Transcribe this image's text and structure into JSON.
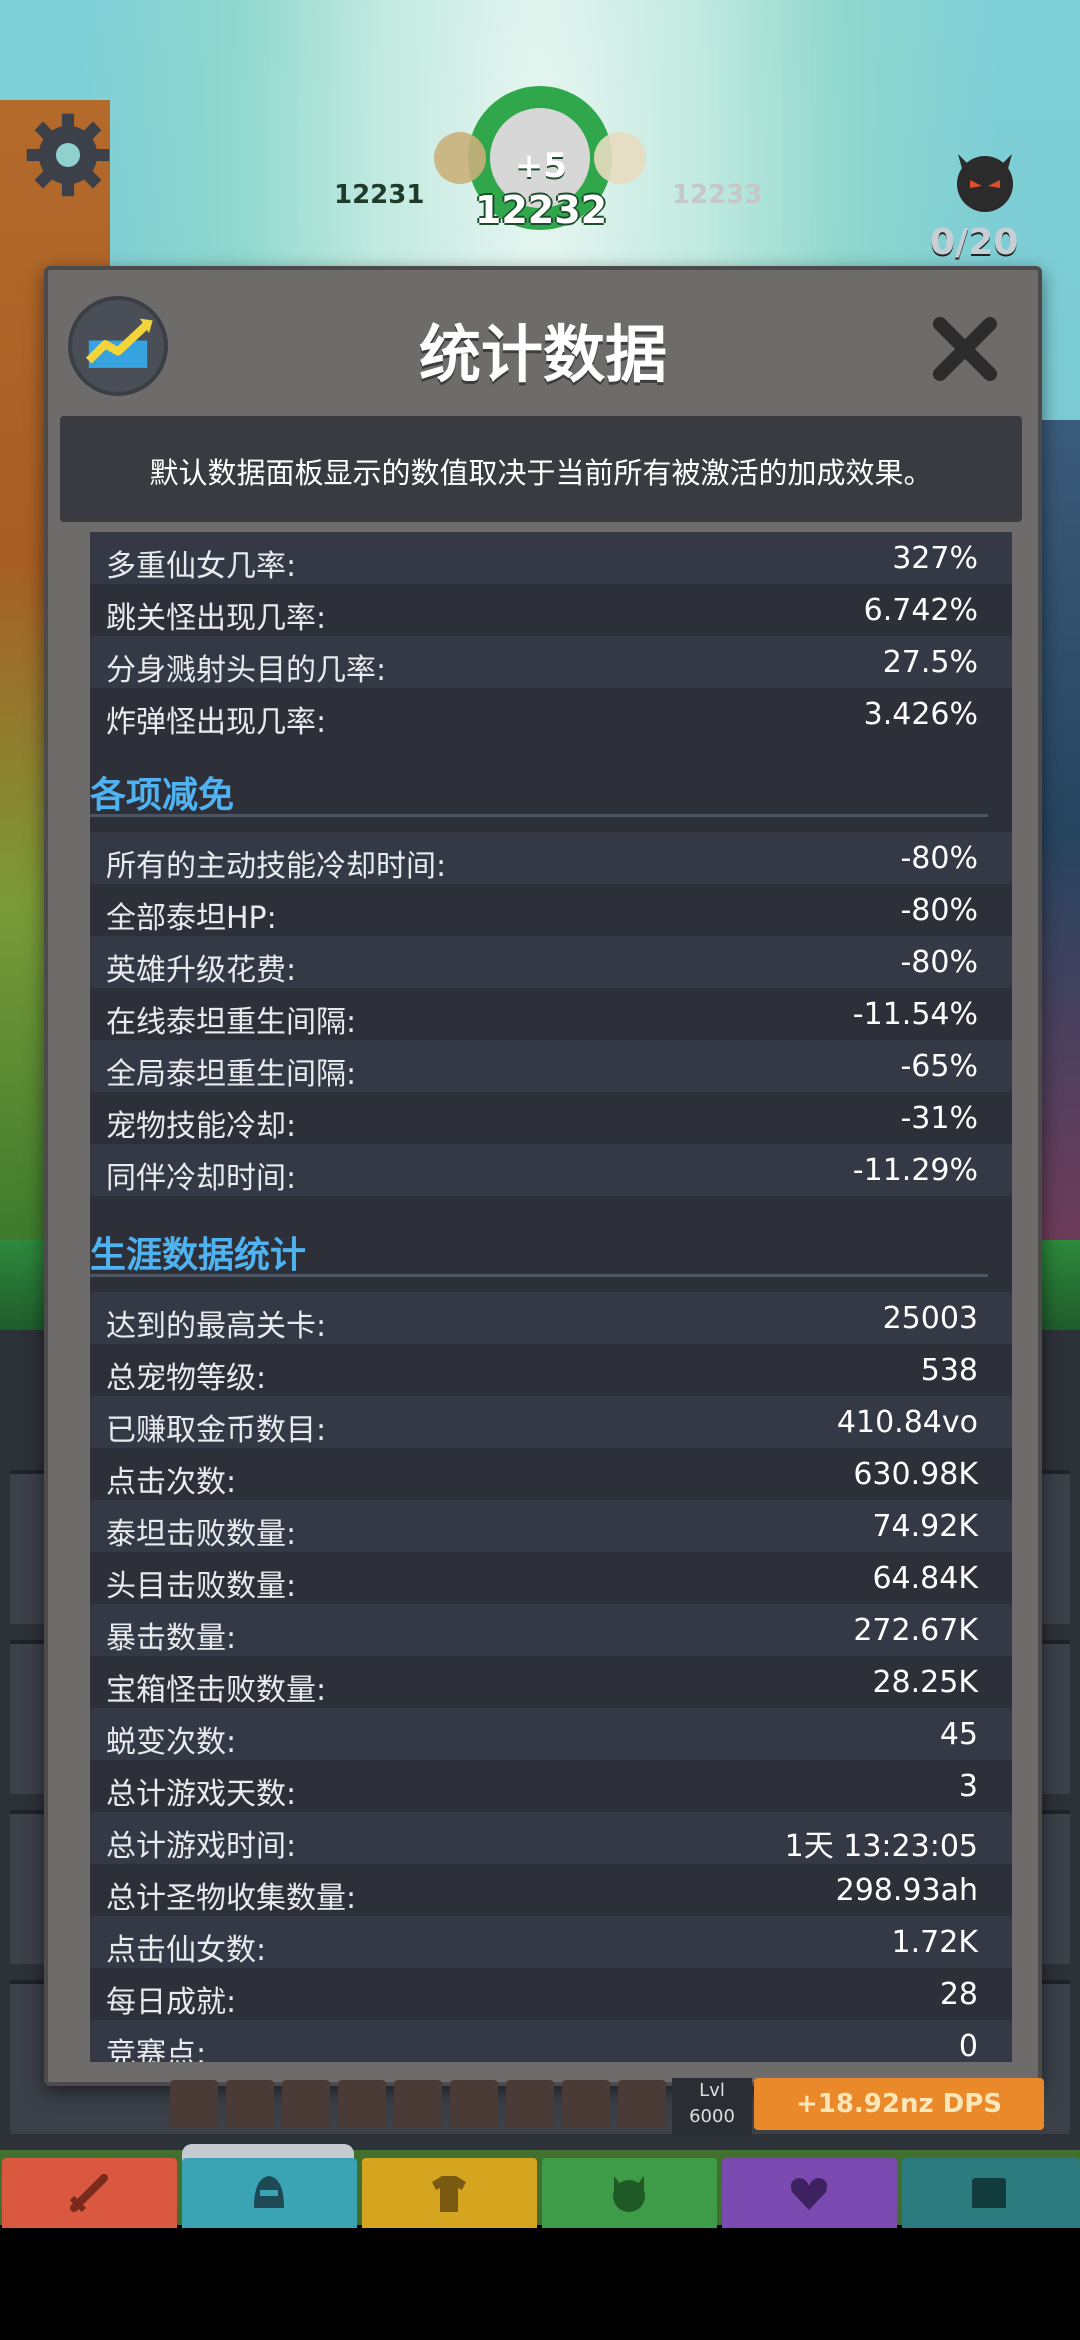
{
  "hud": {
    "prev_stage": "12231",
    "current_stage": "12232",
    "next_stage": "12233",
    "stage_bonus": "+5",
    "boss_counter": "0/20"
  },
  "dialog": {
    "title": "统计数据",
    "note": "默认数据面板显示的数值取决于当前所有被激活的加成效果。"
  },
  "stats": {
    "top_rows": [
      {
        "label": "多重仙女几率:",
        "value": "327%"
      },
      {
        "label": "跳关怪出现几率:",
        "value": "6.742%"
      },
      {
        "label": "分身溅射头目的几率:",
        "value": "27.5%"
      },
      {
        "label": "炸弹怪出现几率:",
        "value": "3.426%"
      }
    ],
    "reductions_title": "各项减免",
    "reductions": [
      {
        "label": "所有的主动技能冷却时间:",
        "value": "-80%"
      },
      {
        "label": "全部泰坦HP:",
        "value": "-80%"
      },
      {
        "label": "英雄升级花费:",
        "value": "-80%"
      },
      {
        "label": "在线泰坦重生间隔:",
        "value": "-11.54%"
      },
      {
        "label": "全局泰坦重生间隔:",
        "value": "-65%"
      },
      {
        "label": "宠物技能冷却:",
        "value": "-31%"
      },
      {
        "label": "同伴冷却时间:",
        "value": "-11.29%"
      }
    ],
    "career_title": "生涯数据统计",
    "career": [
      {
        "label": "达到的最高关卡:",
        "value": "25003"
      },
      {
        "label": "总宠物等级:",
        "value": "538"
      },
      {
        "label": "已赚取金币数目:",
        "value": "410.84vo"
      },
      {
        "label": "点击次数:",
        "value": "630.98K"
      },
      {
        "label": "泰坦击败数量:",
        "value": "74.92K"
      },
      {
        "label": "头目击败数量:",
        "value": "64.84K"
      },
      {
        "label": "暴击数量:",
        "value": "272.67K"
      },
      {
        "label": "宝箱怪击败数量:",
        "value": "28.25K"
      },
      {
        "label": "蜕变次数:",
        "value": "45"
      },
      {
        "label": "总计游戏天数:",
        "value": "3"
      },
      {
        "label": "总计游戏时间:",
        "value": "1天 13:23:05"
      },
      {
        "label": "总计圣物收集数量:",
        "value": "298.93ah"
      },
      {
        "label": "点击仙女数:",
        "value": "1.72K"
      },
      {
        "label": "每日成就:",
        "value": "28"
      },
      {
        "label": "竞赛点:",
        "value": "0"
      }
    ]
  },
  "bottom": {
    "lvl_label": "Lvl",
    "lvl_value": "6000",
    "dps_label": "+18.92nz DPS"
  },
  "tabs": [
    {
      "name": "sword",
      "color": "#d9583f",
      "icon": "sword-icon"
    },
    {
      "name": "heroes",
      "color": "#3aa3b4",
      "icon": "helmet-icon"
    },
    {
      "name": "equipment",
      "color": "#d6a51f",
      "icon": "shirt-icon"
    },
    {
      "name": "pets",
      "color": "#3e9c48",
      "icon": "pet-icon"
    },
    {
      "name": "artifacts",
      "color": "#7a4ab0",
      "icon": "heart-icon"
    },
    {
      "name": "shop",
      "color": "#2b7b7f",
      "icon": "chest-icon"
    }
  ],
  "colors": {
    "section_title": "#4fb3f2",
    "panel_bg": "#2d3039",
    "dialog_frame": "#6e6b6b"
  }
}
